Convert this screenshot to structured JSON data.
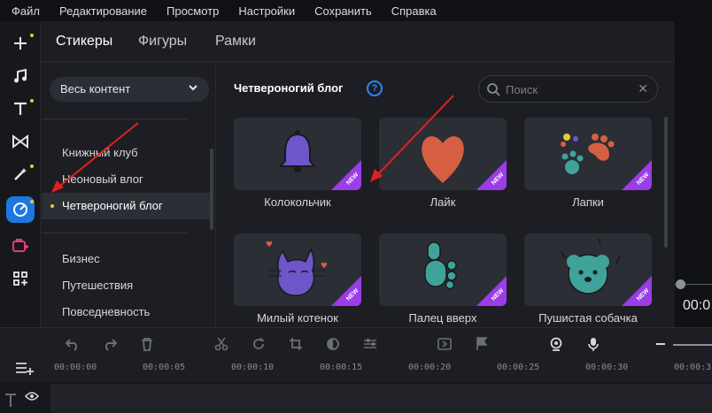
{
  "menu": [
    "Файл",
    "Редактирование",
    "Просмотр",
    "Настройки",
    "Сохранить",
    "Справка"
  ],
  "tabs": [
    "Стикеры",
    "Фигуры",
    "Рамки"
  ],
  "filter": {
    "value": "Весь контент"
  },
  "categories_top": [
    "Книжный клуб",
    "Неоновый влог",
    "Четвероногий блог"
  ],
  "categories_bottom": [
    "Бизнес",
    "Путешествия",
    "Повседневность"
  ],
  "content": {
    "title": "Четвероногий блог",
    "search_placeholder": "Поиск",
    "badge": "NEW",
    "stickers": [
      "Колокольчик",
      "Лайк",
      "Лапки",
      "Милый котенок",
      "Палец вверх",
      "Пушистая собачка"
    ]
  },
  "preview": {
    "timecode": "00:0"
  },
  "timeline": {
    "ticks": [
      "00:00:00",
      "00:00:05",
      "00:00:10",
      "00:00:15",
      "00:00:20",
      "00:00:25",
      "00:00:30",
      "00:00:3"
    ]
  },
  "colors": {
    "accent": "#1b78e0",
    "badge": "#9a3ce8",
    "annotation_arrow": "#e02020"
  }
}
